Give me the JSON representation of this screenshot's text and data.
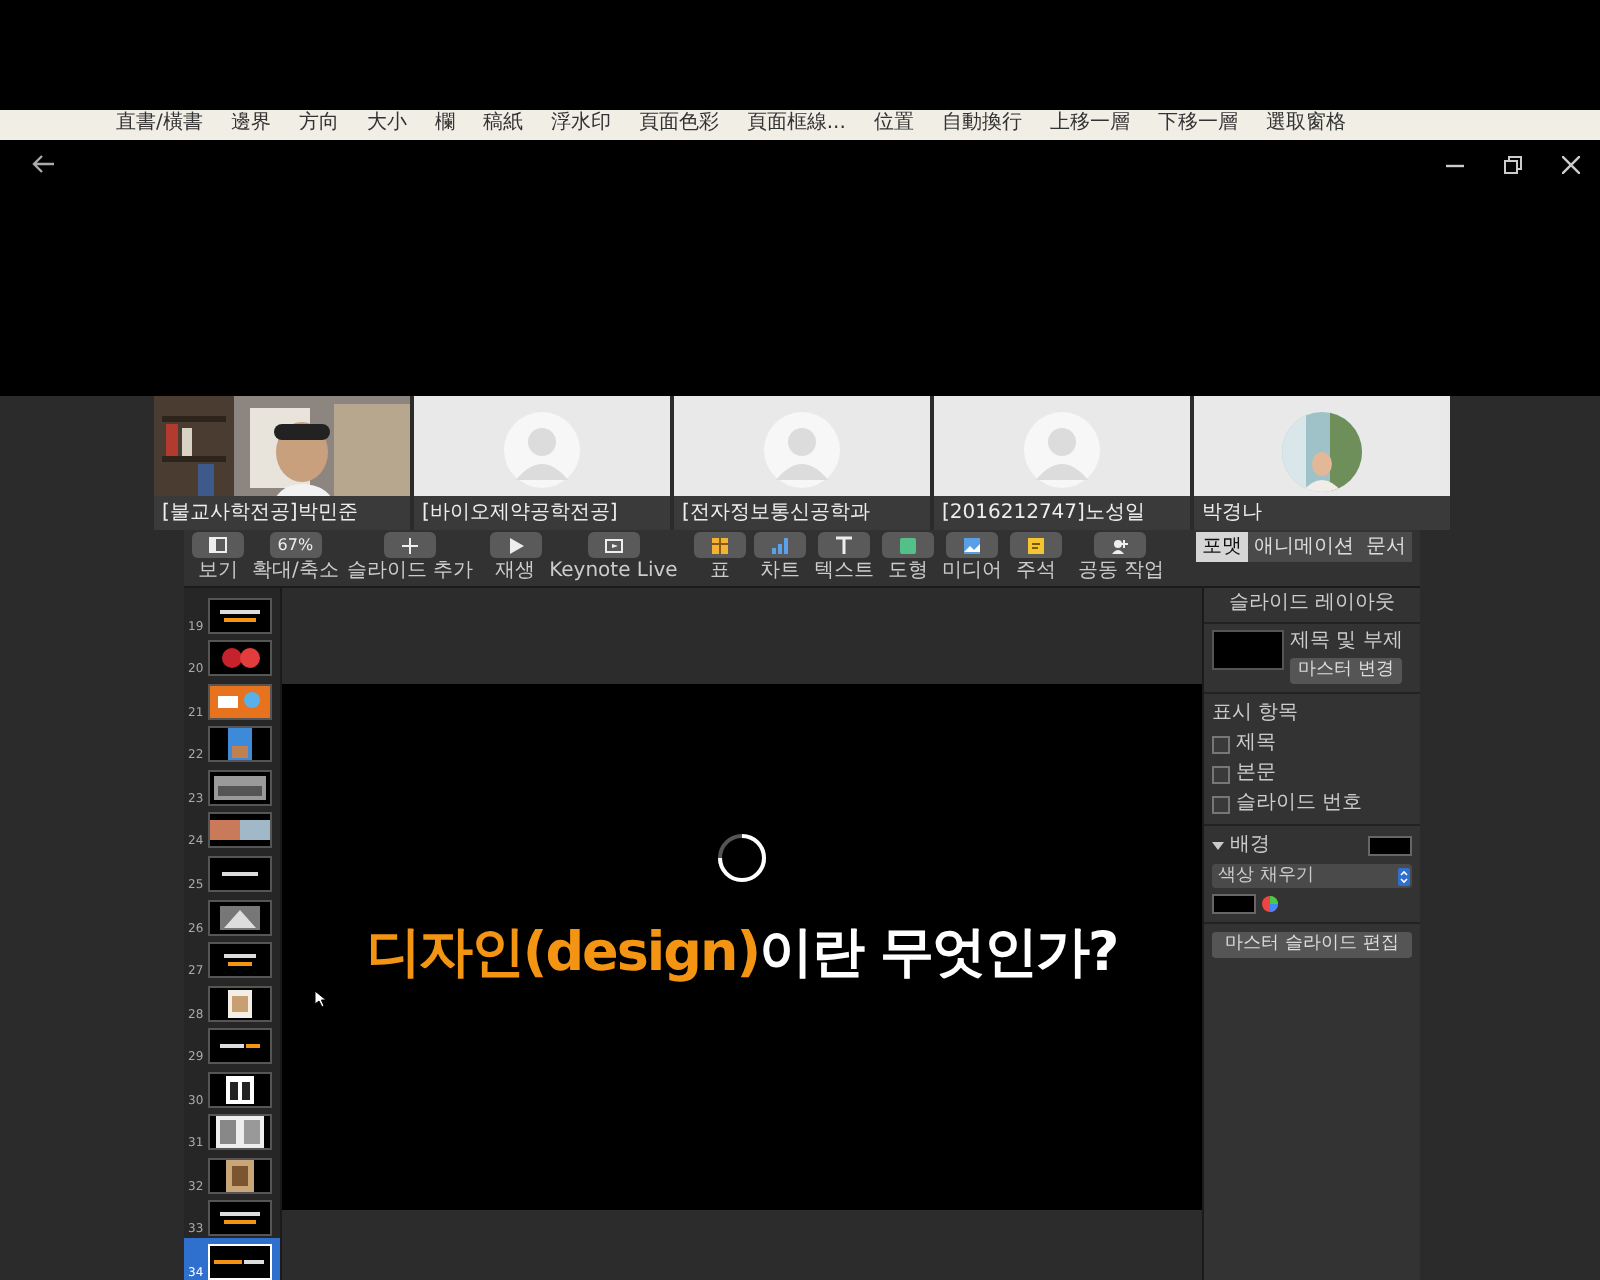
{
  "background_ribbon": {
    "items": [
      "直書/橫書",
      "邊界",
      "方向",
      "大小",
      "欄",
      "稿紙",
      "浮水印",
      "頁面色彩",
      "頁面框線...",
      "位置",
      "自動換行",
      "上移一層",
      "下移一層",
      "選取窗格"
    ]
  },
  "participants": [
    {
      "name": "[불교사학전공]박민준",
      "kind": "video"
    },
    {
      "name": "[바이오제약공학전공]",
      "kind": "avatar"
    },
    {
      "name": "[전자정보통신공학과",
      "kind": "avatar"
    },
    {
      "name": "[2016212747]노성일",
      "kind": "avatar"
    },
    {
      "name": "박경나"
    }
  ],
  "keynote": {
    "toolbar": [
      {
        "label": "보기",
        "kind": "view"
      },
      {
        "label": "확대/축소",
        "kind": "zoom",
        "value": "67%"
      },
      {
        "label": "슬라이드 추가",
        "kind": "add"
      },
      {
        "label": "재생",
        "kind": "play"
      },
      {
        "label": "Keynote Live",
        "kind": "live"
      },
      {
        "label": "표",
        "kind": "table"
      },
      {
        "label": "차트",
        "kind": "chart"
      },
      {
        "label": "텍스트",
        "kind": "text"
      },
      {
        "label": "도형",
        "kind": "shape"
      },
      {
        "label": "미디어",
        "kind": "media"
      },
      {
        "label": "주석",
        "kind": "comment"
      },
      {
        "label": "공동 작업",
        "kind": "collab"
      }
    ],
    "inspector_tabs": [
      {
        "label": "포맷",
        "selected": true
      },
      {
        "label": "애니메이션",
        "selected": false
      },
      {
        "label": "문서",
        "selected": false
      }
    ],
    "slides": [
      {
        "number": "19",
        "selected": false
      },
      {
        "number": "20",
        "selected": false
      },
      {
        "number": "21",
        "selected": false
      },
      {
        "number": "22",
        "selected": false
      },
      {
        "number": "23",
        "selected": false
      },
      {
        "number": "24",
        "selected": false
      },
      {
        "number": "25",
        "selected": false
      },
      {
        "number": "26",
        "selected": false
      },
      {
        "number": "27",
        "selected": false
      },
      {
        "number": "28",
        "selected": false
      },
      {
        "number": "29",
        "selected": false
      },
      {
        "number": "30",
        "selected": false
      },
      {
        "number": "31",
        "selected": false
      },
      {
        "number": "32",
        "selected": false
      },
      {
        "number": "33",
        "selected": false
      },
      {
        "number": "34",
        "selected": true
      }
    ],
    "slide": {
      "title_highlight": "디자인(design)",
      "title_rest": "이란 무엇인가?",
      "loading": true
    },
    "inspector": {
      "title": "슬라이드 레이아웃",
      "layout_name": "제목 및 부제",
      "change_master": "마스터 변경",
      "appearance_heading": "표시 항목",
      "options": [
        {
          "label": "제목",
          "checked": false
        },
        {
          "label": "본문",
          "checked": false
        },
        {
          "label": "슬라이드 번호",
          "checked": false
        }
      ],
      "background": {
        "label": "배경",
        "expanded": true,
        "color": "#000000",
        "fill": "색상 채우기"
      },
      "edit_master": "마스터 슬라이드 편집"
    }
  }
}
